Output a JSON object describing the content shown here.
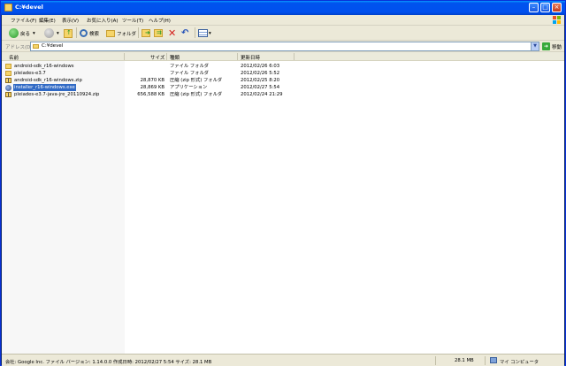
{
  "window": {
    "title": "C:¥devel"
  },
  "menu": [
    "ファイル(F)",
    "編集(E)",
    "表示(V)",
    "お気に入り(A)",
    "ツール(T)",
    "ヘルプ(H)"
  ],
  "toolbar": {
    "back_label": "戻る",
    "search_label": "検索",
    "folders_label": "フォルダ"
  },
  "address": {
    "label": "アドレス(D)",
    "value": "C:¥devel",
    "go_label": "移動"
  },
  "columns": {
    "name": "名前",
    "size": "サイズ",
    "type": "種類",
    "modified": "更新日時"
  },
  "files": [
    {
      "name": "android-sdk_r16-windows",
      "size": "",
      "type": "ファイル フォルダ",
      "modified": "2012/02/26 6:03",
      "icon": "folder-icon",
      "selected": false
    },
    {
      "name": "pleiades-e3.7",
      "size": "",
      "type": "ファイル フォルダ",
      "modified": "2012/02/26 5:52",
      "icon": "folder-icon",
      "selected": false
    },
    {
      "name": "android-sdk_r16-windows.zip",
      "size": "28,870 KB",
      "type": "圧縮 (zip 形式) フォルダ",
      "modified": "2012/02/25 8:20",
      "icon": "zip-folder-icon",
      "selected": false
    },
    {
      "name": "installer_r16-windows.exe",
      "size": "28,869 KB",
      "type": "アプリケーション",
      "modified": "2012/02/27 5:54",
      "icon": "installer-icon",
      "selected": true
    },
    {
      "name": "pleiades-e3.7-java-jre_20110924.zip",
      "size": "656,588 KB",
      "type": "圧縮 (zip 形式) フォルダ",
      "modified": "2012/02/24 21:29",
      "icon": "zip-folder-icon",
      "selected": false
    }
  ],
  "status": {
    "details": "会社: Google Inc. ファイル バージョン: 1.14.0.0 作成日時: 2012/02/27 5:54 サイズ: 28.1 MB",
    "size": "28.1 MB",
    "location": "マイ コンピュータ"
  },
  "colors": {
    "titlebar": "#0054e3",
    "selection": "#316ac5",
    "chrome": "#ece9d8"
  }
}
